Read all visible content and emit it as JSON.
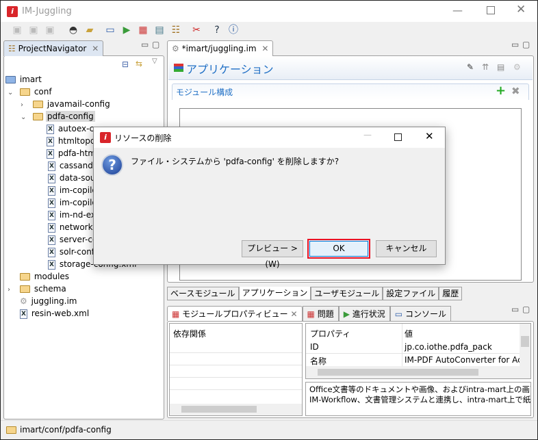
{
  "window": {
    "title": "IM-Juggling"
  },
  "navigator": {
    "tab": "ProjectNavigator",
    "tree": [
      {
        "label": "imart",
        "type": "project",
        "depth": 0
      },
      {
        "label": "conf",
        "type": "folder",
        "depth": 1,
        "expanded": true
      },
      {
        "label": "javamail-config",
        "type": "folder",
        "depth": 2,
        "expanded": false
      },
      {
        "label": "pdfa-config",
        "type": "folder",
        "depth": 2,
        "expanded": true,
        "selected": true
      },
      {
        "label": "autoex-co",
        "type": "xml",
        "depth": 3
      },
      {
        "label": "htmltopdf",
        "type": "xml",
        "depth": 3
      },
      {
        "label": "pdfa-htm",
        "type": "xml",
        "depth": 3
      },
      {
        "label": "cassandra-co",
        "type": "xml",
        "depth": 2
      },
      {
        "label": "data-source-",
        "type": "xml",
        "depth": 2
      },
      {
        "label": "im-copilot-ac",
        "type": "xml",
        "depth": 2
      },
      {
        "label": "im-copilot-dr",
        "type": "xml",
        "depth": 2
      },
      {
        "label": "im-nd-extrac",
        "type": "xml",
        "depth": 2
      },
      {
        "label": "network-agen",
        "type": "xml",
        "depth": 2
      },
      {
        "label": "server-contex",
        "type": "xml",
        "depth": 2
      },
      {
        "label": "solr-config.xr",
        "type": "xml",
        "depth": 2
      },
      {
        "label": "storage-config.xml",
        "type": "xml",
        "depth": 2
      },
      {
        "label": "modules",
        "type": "folder",
        "depth": 1
      },
      {
        "label": "schema",
        "type": "folder",
        "depth": 1,
        "expanded": false
      },
      {
        "label": "juggling.im",
        "type": "gear",
        "depth": 1
      },
      {
        "label": "resin-web.xml",
        "type": "xml",
        "depth": 1
      }
    ]
  },
  "editor": {
    "tab": "*imart/juggling.im",
    "heading": "アプリケーション",
    "section": "モジュール構成",
    "bottom_tabs": [
      "ベースモジュール",
      "アプリケーション",
      "ユーザモジュール",
      "設定ファイル",
      "履歴"
    ],
    "active_bottom_tab": 1
  },
  "views": {
    "tabs": [
      "モジュールプロパティビュー",
      "問題",
      "進行状況",
      "コンソール"
    ],
    "dependencies_header": "依存関係",
    "props_headers": [
      "プロパティ",
      "値"
    ],
    "props_rows": [
      [
        "ID",
        "jp.co.iothe.pdfa_pack"
      ],
      [
        "名称",
        "IM-PDF AutoConverter for Accel"
      ]
    ],
    "description": [
      "Office文書等のドキュメントや画像、およびintra-mart上の画面（H",
      "IM-Workflow、文書管理システムと連携し、intra-mart上で紙と違"
    ]
  },
  "status": {
    "path": "imart/conf/pdfa-config"
  },
  "dialog": {
    "title": "リソースの削除",
    "message": "ファイル・システムから 'pdfa-config' を削除しますか?",
    "preview": "プレビュー >(W)",
    "ok": "OK",
    "cancel": "キャンセル",
    "highlight": "#e81123"
  }
}
